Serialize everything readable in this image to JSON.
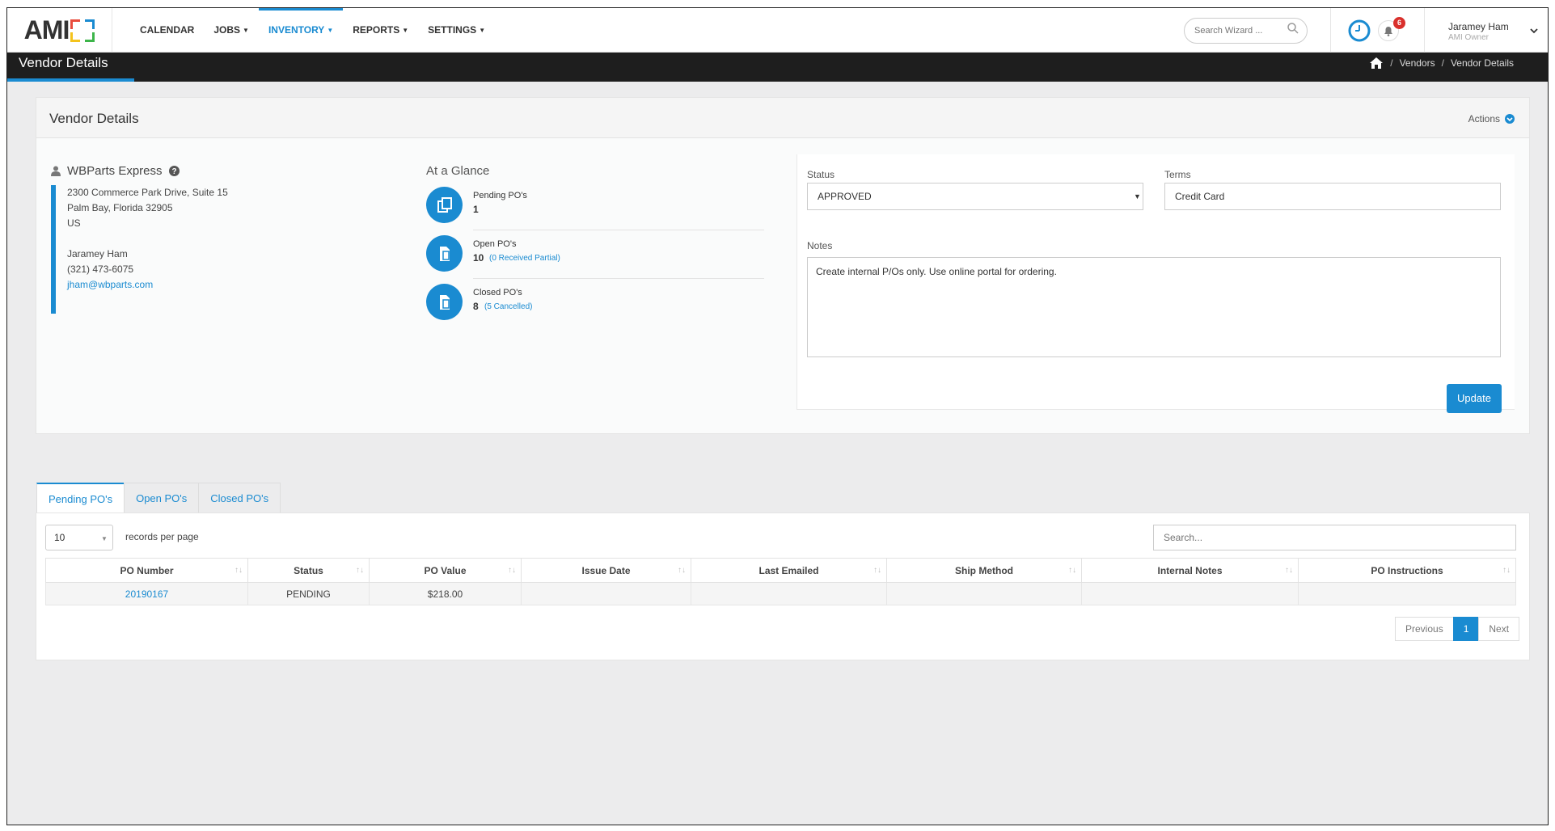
{
  "nav": {
    "logo": "AMI",
    "items": [
      {
        "label": "CALENDAR",
        "caret": false,
        "active": false
      },
      {
        "label": "JOBS",
        "caret": true,
        "active": false
      },
      {
        "label": "INVENTORY",
        "caret": true,
        "active": true
      },
      {
        "label": "REPORTS",
        "caret": true,
        "active": false
      },
      {
        "label": "SETTINGS",
        "caret": true,
        "active": false
      }
    ],
    "search_placeholder": "Search Wizard ...",
    "notification_count": "6",
    "user_name": "Jaramey Ham",
    "user_role": "AMI Owner"
  },
  "titlebar": {
    "title": "Vendor Details",
    "breadcrumb": [
      "Vendors",
      "Vendor Details"
    ]
  },
  "panel": {
    "title": "Vendor Details",
    "actions_label": "Actions"
  },
  "vendor": {
    "name": "WBParts Express",
    "address_line1": "2300 Commerce Park Drive, Suite 15",
    "address_line2": "Palm Bay, Florida 32905",
    "country": "US",
    "contact_name": "Jaramey Ham",
    "phone": "(321) 473-6075",
    "email": "jham@wbparts.com"
  },
  "glance": {
    "title": "At a Glance",
    "pending": {
      "label": "Pending PO's",
      "value": "1"
    },
    "open": {
      "label": "Open PO's",
      "value": "10",
      "sub": "(0 Received Partial)"
    },
    "closed": {
      "label": "Closed PO's",
      "value": "8",
      "sub": "(5 Cancelled)"
    }
  },
  "form": {
    "status_label": "Status",
    "status_value": "APPROVED",
    "terms_label": "Terms",
    "terms_value": "Credit Card",
    "notes_label": "Notes",
    "notes_value": "Create internal P/Os only. Use online portal for ordering.",
    "update_label": "Update"
  },
  "tabs": [
    "Pending PO's",
    "Open PO's",
    "Closed PO's"
  ],
  "table": {
    "records_per_page": "10",
    "records_label": "records per page",
    "search_placeholder": "Search...",
    "columns": [
      "PO Number",
      "Status",
      "PO Value",
      "Issue Date",
      "Last Emailed",
      "Ship Method",
      "Internal Notes",
      "PO Instructions"
    ],
    "rows": [
      {
        "po_number": "20190167",
        "status": "PENDING",
        "po_value": "$218.00",
        "issue_date": "",
        "last_emailed": "",
        "ship_method": "",
        "internal_notes": "",
        "po_instructions": ""
      }
    ],
    "pager": {
      "previous": "Previous",
      "page": "1",
      "next": "Next"
    }
  },
  "colors": {
    "accent": "#1a8bd1",
    "dark_bar": "#1e1e1e",
    "badge": "#d9302c"
  }
}
